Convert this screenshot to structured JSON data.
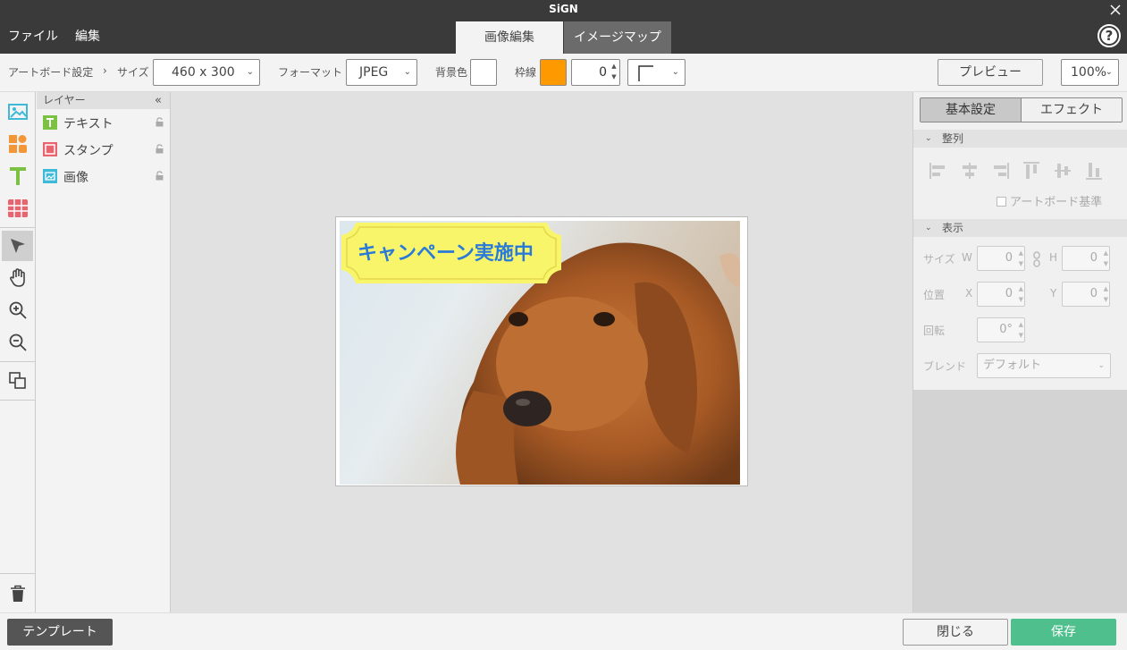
{
  "app": {
    "title": "SiGN"
  },
  "menu": {
    "file": "ファイル",
    "edit": "編集"
  },
  "tabs": [
    {
      "label": "画像編集"
    },
    {
      "label": "イメージマップ"
    }
  ],
  "help_label": "?",
  "toolbar": {
    "artboard_settings": "アートボード設定",
    "breadcrumb_sep": "›",
    "size_label": "サイズ",
    "size_value": "460 x 300",
    "format_label": "フォーマット",
    "format_value": "JPEG",
    "bg_color_label": "背景色",
    "bg_color": "#ffffff",
    "border_label": "枠線",
    "border_color": "#ff9900",
    "border_width": "0",
    "preview_label": "プレビュー",
    "zoom_value": "100%"
  },
  "layers": {
    "header": "レイヤー",
    "collapse_icon": "«",
    "items": [
      {
        "label": "テキスト",
        "icon": "text-layer-icon",
        "color": "#7cc242"
      },
      {
        "label": "スタンプ",
        "icon": "stamp-layer-icon",
        "color": "#e8646f"
      },
      {
        "label": "画像",
        "icon": "image-layer-icon",
        "color": "#3fb9d8"
      }
    ]
  },
  "canvas": {
    "stamp_text": "キャンペーン実施中"
  },
  "right_panel": {
    "tab_basic": "基本設定",
    "tab_effect": "エフェクト",
    "align_header": "整列",
    "artboard_basis": "アートボード基準",
    "display_header": "表示",
    "size_label": "サイズ",
    "w_label": "W",
    "w_value": "0",
    "h_label": "H",
    "h_value": "0",
    "position_label": "位置",
    "x_label": "X",
    "x_value": "0",
    "y_label": "Y",
    "y_value": "0",
    "rotation_label": "回転",
    "rotation_value": "0°",
    "blend_label": "ブレンド",
    "blend_value": "デフォルト"
  },
  "bottom": {
    "template": "テンプレート",
    "close": "閉じる",
    "save": "保存"
  },
  "colors": {
    "titlebar": "#3a3a3a",
    "accent_save": "#4fc08d",
    "template_btn": "#555555"
  }
}
